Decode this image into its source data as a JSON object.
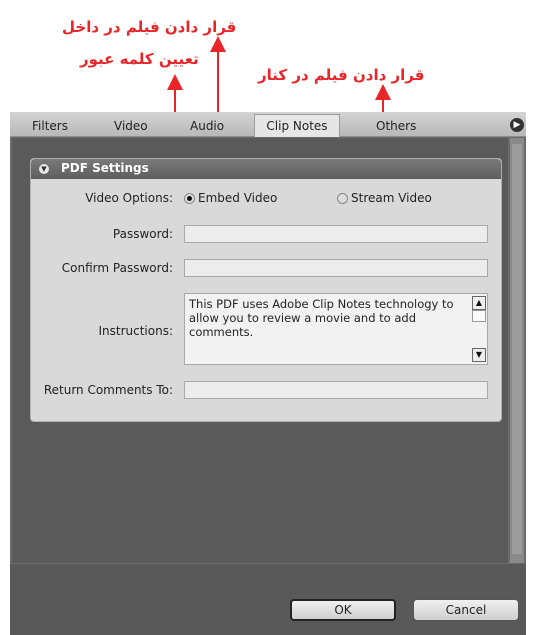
{
  "annotations": {
    "embed_inside": "قرار دادن فیلم در داخل",
    "set_password": "تعیین کلمه عبور",
    "stream_beside": "قرار دادن فیلم در کنار"
  },
  "tabs": [
    {
      "label": "Filters"
    },
    {
      "label": "Video"
    },
    {
      "label": "Audio"
    },
    {
      "label": "Clip Notes"
    },
    {
      "label": "Others"
    }
  ],
  "active_tab": "Clip Notes",
  "pdf_settings": {
    "title": "PDF Settings",
    "video_options_label": "Video Options:",
    "embed_label": "Embed Video",
    "stream_label": "Stream Video",
    "selected_option": "Embed Video",
    "password_label": "Password:",
    "password_value": "",
    "confirm_label": "Confirm Password:",
    "confirm_value": "",
    "instructions_label": "Instructions:",
    "instructions_value": "This PDF uses Adobe Clip Notes technology to allow you to review a movie and to add comments.",
    "return_label": "Return Comments To:",
    "return_value": ""
  },
  "buttons": {
    "ok": "OK",
    "cancel": "Cancel"
  },
  "colors": {
    "annotation": "#e8262a",
    "panel": "#d9d9d9",
    "dark": "#5a5a5a"
  }
}
